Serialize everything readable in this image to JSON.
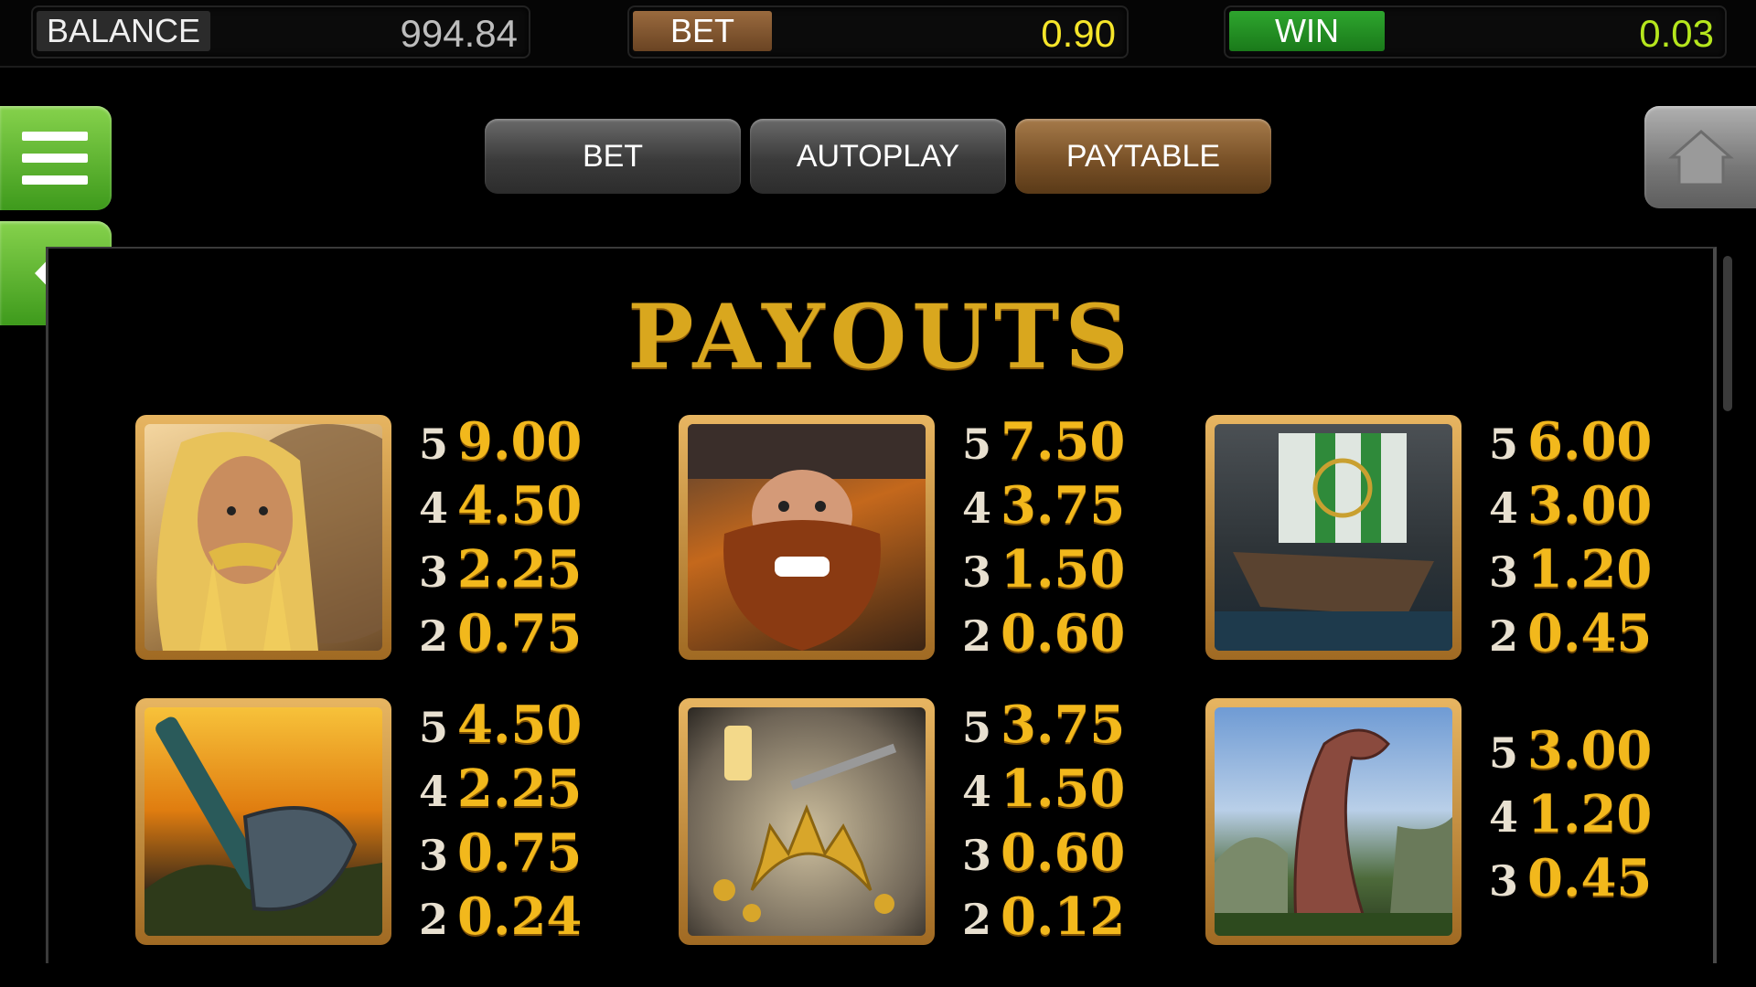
{
  "status_bar": {
    "balance": {
      "label": "BALANCE",
      "value": "994.84"
    },
    "bet": {
      "label": "BET",
      "value": "0.90"
    },
    "win": {
      "label": "WIN",
      "value": "0.03"
    }
  },
  "tabs": [
    {
      "label": "BET",
      "active": false
    },
    {
      "label": "AUTOPLAY",
      "active": false
    },
    {
      "label": "PAYTABLE",
      "active": true
    }
  ],
  "side_buttons": {
    "menu": "hamburger-menu-icon",
    "back": "back-arrow-icon",
    "home": "home-icon"
  },
  "paytable": {
    "title": "PAYOUTS",
    "symbols": [
      {
        "name": "blonde-viking",
        "pays": [
          {
            "count": "5",
            "amount": "9.00"
          },
          {
            "count": "4",
            "amount": "4.50"
          },
          {
            "count": "3",
            "amount": "2.25"
          },
          {
            "count": "2",
            "amount": "0.75"
          }
        ]
      },
      {
        "name": "red-bearded-viking",
        "pays": [
          {
            "count": "5",
            "amount": "7.50"
          },
          {
            "count": "4",
            "amount": "3.75"
          },
          {
            "count": "3",
            "amount": "1.50"
          },
          {
            "count": "2",
            "amount": "0.60"
          }
        ]
      },
      {
        "name": "viking-longship",
        "pays": [
          {
            "count": "5",
            "amount": "6.00"
          },
          {
            "count": "4",
            "amount": "3.00"
          },
          {
            "count": "3",
            "amount": "1.20"
          },
          {
            "count": "2",
            "amount": "0.45"
          }
        ]
      },
      {
        "name": "battle-axe",
        "pays": [
          {
            "count": "5",
            "amount": "4.50"
          },
          {
            "count": "4",
            "amount": "2.25"
          },
          {
            "count": "3",
            "amount": "0.75"
          },
          {
            "count": "2",
            "amount": "0.24"
          }
        ]
      },
      {
        "name": "treasure-tiara",
        "pays": [
          {
            "count": "5",
            "amount": "3.75"
          },
          {
            "count": "4",
            "amount": "1.50"
          },
          {
            "count": "3",
            "amount": "0.60"
          },
          {
            "count": "2",
            "amount": "0.12"
          }
        ]
      },
      {
        "name": "dragon-prow",
        "pays": [
          {
            "count": "5",
            "amount": "3.00"
          },
          {
            "count": "4",
            "amount": "1.20"
          },
          {
            "count": "3",
            "amount": "0.45"
          }
        ]
      }
    ]
  },
  "colors": {
    "gold": "#f2b81c",
    "bet_value": "#f5e52a",
    "win_value": "#b5e61d",
    "green_button": "#5cb32e",
    "bet_label": "#8a5c33",
    "win_label": "#239523"
  }
}
